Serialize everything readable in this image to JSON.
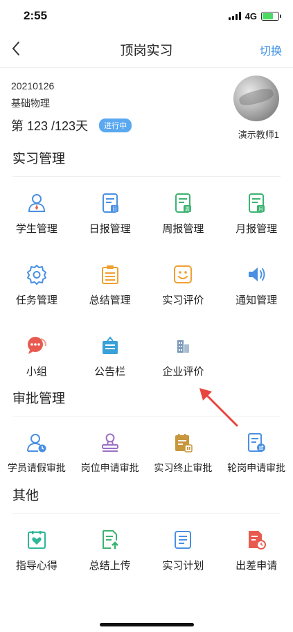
{
  "status_bar": {
    "time": "2:55",
    "network": "4G"
  },
  "nav": {
    "back_icon": "chevron-left-icon",
    "title": "顶岗实习",
    "switch_label": "切换"
  },
  "profile": {
    "code": "20210126",
    "subject": "基础物理",
    "days": "第 123 /123天",
    "status_badge": "进行中",
    "teacher_name": "演示教师1"
  },
  "sections": {
    "internship": {
      "title": "实习管理",
      "items": [
        {
          "label": "学生管理",
          "icon": "student-icon",
          "color": "#4a90e2"
        },
        {
          "label": "日报管理",
          "icon": "daily-report-icon",
          "color": "#4a90e2"
        },
        {
          "label": "周报管理",
          "icon": "weekly-report-icon",
          "color": "#3cb371"
        },
        {
          "label": "月报管理",
          "icon": "monthly-report-icon",
          "color": "#3cb371"
        },
        {
          "label": "任务管理",
          "icon": "task-gear-icon",
          "color": "#4a90e2"
        },
        {
          "label": "总结管理",
          "icon": "summary-icon",
          "color": "#f0a030"
        },
        {
          "label": "实习评价",
          "icon": "evaluation-smile-icon",
          "color": "#f0a030"
        },
        {
          "label": "通知管理",
          "icon": "speaker-icon",
          "color": "#4a90e2"
        },
        {
          "label": "小组",
          "icon": "chat-group-icon",
          "color": "#e85a4f"
        },
        {
          "label": "公告栏",
          "icon": "bulletin-board-icon",
          "color": "#3aa0d8"
        },
        {
          "label": "企业评价",
          "icon": "building-icon",
          "color": "#7a9ab8"
        }
      ]
    },
    "approval": {
      "title": "审批管理",
      "items": [
        {
          "label": "学员请假审批",
          "icon": "leave-approval-icon",
          "color": "#4a90e2"
        },
        {
          "label": "岗位申请审批",
          "icon": "stamp-icon",
          "color": "#9b6fc6"
        },
        {
          "label": "实习终止审批",
          "icon": "terminate-icon",
          "color": "#c8963c"
        },
        {
          "label": "轮岗申请审批",
          "icon": "rotation-icon",
          "color": "#4a90e2"
        }
      ]
    },
    "other": {
      "title": "其他",
      "items": [
        {
          "label": "指导心得",
          "icon": "guidance-heart-icon",
          "color": "#2fb79a"
        },
        {
          "label": "总结上传",
          "icon": "upload-icon",
          "color": "#3cb371"
        },
        {
          "label": "实习计划",
          "icon": "plan-icon",
          "color": "#4a90e2"
        },
        {
          "label": "出差申请",
          "icon": "business-trip-icon",
          "color": "#e85a4f"
        }
      ]
    }
  }
}
